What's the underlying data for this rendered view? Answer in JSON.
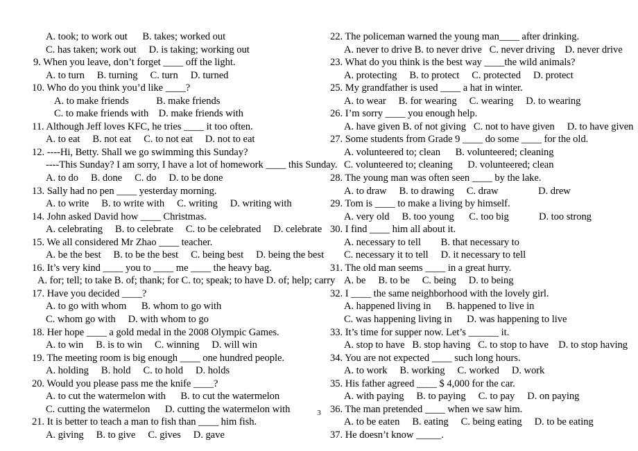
{
  "document": {
    "type": "grammar-multiple-choice-worksheet",
    "page_number": "3",
    "background_color": "#ffffff",
    "text_color": "#000000"
  },
  "left_column": {
    "lines": [
      {
        "id": "l1",
        "indent": "opt",
        "text": "A. took; to work out      B. takes; worked out"
      },
      {
        "id": "l2",
        "indent": "opt",
        "text": "C. has taken; work out     D. is taking; working out"
      },
      {
        "id": "l3",
        "indent": "q",
        "text": "9. When you leave, don’t forget ____ off the light."
      },
      {
        "id": "l4",
        "indent": "opt",
        "text": "A. to turn     B. turning     C. turn     D. turned"
      },
      {
        "id": "l5",
        "indent": "q-nar",
        "text": "10. Who do you think you’d like ____?"
      },
      {
        "id": "l6",
        "indent": "opt-deep",
        "text": "A. to make friends           B. make friends"
      },
      {
        "id": "l7",
        "indent": "opt-deep",
        "text": "C. to make friends with    D. make friends with"
      },
      {
        "id": "l8",
        "indent": "q-nar",
        "text": "11. Although Jeff loves KFC, he tries ____ it too often."
      },
      {
        "id": "l9",
        "indent": "opt",
        "text": "A. to eat     B. not eat     C. to not eat     D. not to eat"
      },
      {
        "id": "l10",
        "indent": "q-nar",
        "text": "12. ----Hi, Betty. Shall we go swimming this Sunday?"
      },
      {
        "id": "l11",
        "indent": "cont",
        "text": "----This Sunday? I am sorry, I have a lot of homework ____ this Sunday."
      },
      {
        "id": "l12",
        "indent": "opt",
        "text": "A. to do     B. done     C. do     D. to be done"
      },
      {
        "id": "l13",
        "indent": "q-nar",
        "text": "13. Sally had no pen ____ yesterday morning."
      },
      {
        "id": "l14",
        "indent": "opt",
        "text": "A. to write     B. to write with     C. writing     D. writing with"
      },
      {
        "id": "l15",
        "indent": "q-nar",
        "text": "14. John asked David how ____ Christmas."
      },
      {
        "id": "l16",
        "indent": "opt",
        "text": "A. celebrating     B. to celebrate     C. to be celebrated     D. celebrate"
      },
      {
        "id": "l17",
        "indent": "q-nar",
        "text": "15. We all considered Mr Zhao ____ teacher."
      },
      {
        "id": "l18",
        "indent": "opt",
        "text": "A. be the best     B. to be the best     C. being best     D. being the best"
      },
      {
        "id": "l19",
        "indent": "q-nar",
        "text": "16. It’s very kind ____ you to ____ me ____ the heavy bag."
      },
      {
        "id": "l20",
        "indent": "opt-shal",
        "text": "A. for; tell; to take B. of; thank; for C. to; speak; to have D. of; help; carry"
      },
      {
        "id": "l21",
        "indent": "q-nar",
        "text": "17. Have you decided ____?"
      },
      {
        "id": "l22",
        "indent": "opt",
        "text": "A. to go with whom      B. whom to go with"
      },
      {
        "id": "l23",
        "indent": "opt",
        "text": "C. whom go with     D. with whom to go"
      },
      {
        "id": "l24",
        "indent": "q-nar",
        "text": "18. Her hope ____ a gold medal in the 2008 Olympic Games."
      },
      {
        "id": "l25",
        "indent": "opt",
        "text": "A. to win     B. is to win     C. winning     D. will win"
      },
      {
        "id": "l26",
        "indent": "q-nar",
        "text": "19. The meeting room is big enough ____ one hundred people."
      },
      {
        "id": "l27",
        "indent": "opt",
        "text": "A. holding     B. hold     C. to hold     D. holds"
      },
      {
        "id": "l28",
        "indent": "q-nar",
        "text": "20. Would you please pass me the knife ____?"
      },
      {
        "id": "l29",
        "indent": "opt",
        "text": "A. to cut the watermelon with      B. to cut the watermelon"
      },
      {
        "id": "l30",
        "indent": "opt",
        "text": "C. cutting the watermelon      D. cutting the watermelon with"
      },
      {
        "id": "l31",
        "indent": "q-nar",
        "text": "21. It is better to teach a man to fish than ____ him fish."
      },
      {
        "id": "l32",
        "indent": "opt",
        "text": "A. giving     B. to give     C. gives     D. gave"
      }
    ]
  },
  "right_column": {
    "lines": [
      {
        "id": "r1",
        "indent": "q-nar",
        "text": "22. The policeman warned the young man____ after drinking."
      },
      {
        "id": "r2",
        "indent": "opt",
        "text": "A. never to drive B. to never drive   C. never driving    D. never drive"
      },
      {
        "id": "r3",
        "indent": "q-nar",
        "text": "23. What do you think is the best way ____the wild animals?"
      },
      {
        "id": "r4",
        "indent": "opt",
        "text": "A. protecting     B. to protect     C. protected     D. protect"
      },
      {
        "id": "r5",
        "indent": "q-nar",
        "text": "25. My grandfather is used ____ a hat in winter."
      },
      {
        "id": "r6",
        "indent": "opt",
        "text": "A. to wear     B. for wearing     C. wearing     D. to wearing"
      },
      {
        "id": "r7",
        "indent": "q-nar",
        "text": "26. I’m sorry ____ you enough help."
      },
      {
        "id": "r8",
        "indent": "opt",
        "text": "A. have given B. of not giving   C. not to have given     D. to have given"
      },
      {
        "id": "r9",
        "indent": "q-nar",
        "text": "27. Some students from Grade 9 ____ do some ____ for the old."
      },
      {
        "id": "r10",
        "indent": "opt",
        "text": "A. volunteered to; clean      B. volunteered; cleaning"
      },
      {
        "id": "r11",
        "indent": "opt",
        "text": "C. volunteered to; cleaning      D. volunteered; clean"
      },
      {
        "id": "r12",
        "indent": "q-nar",
        "text": "28. The young man was often seen ____ by the lake."
      },
      {
        "id": "r13",
        "indent": "opt",
        "text": "A. to draw     B. to drawing     C. draw                D. drew"
      },
      {
        "id": "r14",
        "indent": "q-nar",
        "text": "29. Tom is ____ to make a living by himself."
      },
      {
        "id": "r15",
        "indent": "opt",
        "text": "A. very old     B. too young      C. too big            D. too strong"
      },
      {
        "id": "r16",
        "indent": "q-nar",
        "text": "30. I find ____ him all about it."
      },
      {
        "id": "r17",
        "indent": "opt",
        "text": "A. necessary to tell        B. that necessary to"
      },
      {
        "id": "r18",
        "indent": "opt",
        "text": "C. necessary it to tell     D. it necessary to tell"
      },
      {
        "id": "r19",
        "indent": "q-nar",
        "text": "31. The old man seems ____ in a great hurry."
      },
      {
        "id": "r20",
        "indent": "opt",
        "text": "A. be     B. to be     C. being     D. to being"
      },
      {
        "id": "r21",
        "indent": "q-nar",
        "text": "32. I ____ the same neighborhood with the lovely girl."
      },
      {
        "id": "r22",
        "indent": "opt",
        "text": "A. happened living in      B. happened to live in"
      },
      {
        "id": "r23",
        "indent": "opt",
        "text": "C. was happening living in      D. was happening to live"
      },
      {
        "id": "r24",
        "indent": "q-nar",
        "text": "33. It’s time for supper now. Let’s ______ it."
      },
      {
        "id": "r25",
        "indent": "opt",
        "text": "A. stop to have   B. stop having   C. to stop to have    D. to stop having"
      },
      {
        "id": "r26",
        "indent": "q-nar",
        "text": "34. You are not expected ____ such long hours."
      },
      {
        "id": "r27",
        "indent": "opt",
        "text": "A. to work     B. working     C. worked     D. work"
      },
      {
        "id": "r28",
        "indent": "q-nar",
        "text": "35. His father agreed ____ $ 4,000 for the car."
      },
      {
        "id": "r29",
        "indent": "opt",
        "text": "A. with paying     B. to paying     C. to pay     D. on paying"
      },
      {
        "id": "r30",
        "indent": "q-nar",
        "text": "36. The man pretended ____ when we saw him."
      },
      {
        "id": "r31",
        "indent": "opt",
        "text": "A. to be eaten     B. eating     C. being eating     D. to be eating"
      },
      {
        "id": "r32",
        "indent": "q-nar",
        "text": "37. He doesn’t know _____."
      }
    ]
  }
}
